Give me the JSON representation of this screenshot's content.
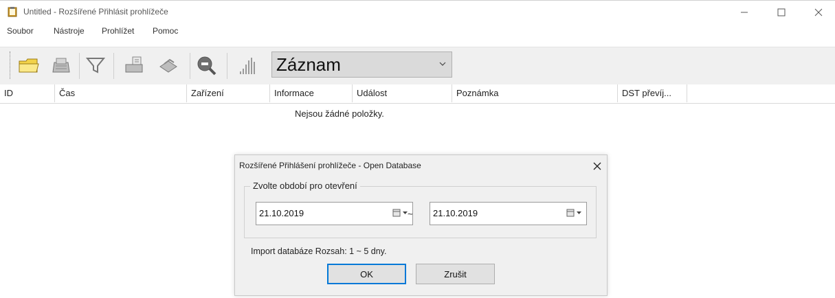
{
  "window": {
    "title": "Untitled - Rozšířené Přihlásit prohlížeče",
    "controls": [
      "minimize",
      "maximize",
      "close"
    ]
  },
  "menu": [
    "Soubor",
    "Nástroje",
    "Prohlížet",
    "Pomoc"
  ],
  "toolbar": {
    "icons": [
      "open-folder-icon",
      "database-icon",
      "filter-icon",
      "print-preview-icon",
      "print-icon",
      "zoom-icon",
      "signal-bars-icon"
    ],
    "combo_value": "Záznam"
  },
  "list": {
    "columns": [
      "ID",
      "Čas",
      "Zařízení",
      "Informace",
      "Událost",
      "Poznámka",
      "DST převíj..."
    ],
    "empty_text": "Nejsou žádné položky."
  },
  "dialog": {
    "title": "Rozšířené Přihlášení prohlížeče - Open Database",
    "group_label": "Zvolte období pro otevření",
    "date_from": "21.10.2019",
    "date_to": "21.10.2019",
    "separator": "~",
    "info": "Import databáze Rozsah: 1 ~ 5 dny.",
    "ok_label": "OK",
    "cancel_label": "Zrušit"
  },
  "colors": {
    "focus_border": "#0078d7",
    "toolbar_bg": "#f0f0f0"
  }
}
